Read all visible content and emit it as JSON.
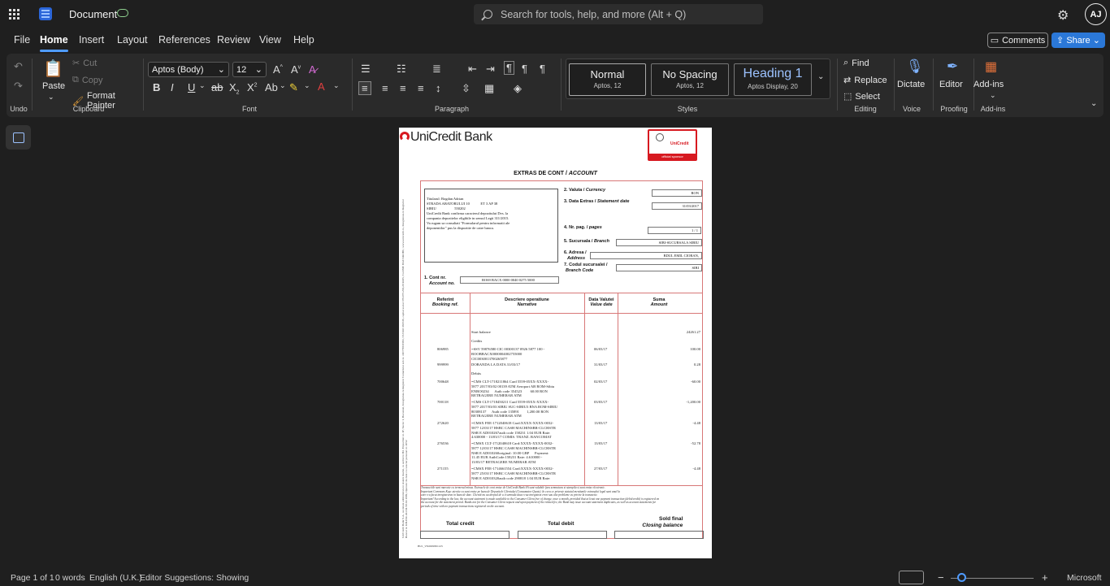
{
  "titlebar": {
    "doc_title": "Document",
    "search_placeholder": "Search for tools, help, and more (Alt + Q)",
    "avatar_initials": "AJ"
  },
  "menu": [
    "File",
    "Home",
    "Insert",
    "Layout",
    "References",
    "Review",
    "View",
    "Help"
  ],
  "actions": {
    "comments": "Comments",
    "share": "Share"
  },
  "ribbon": {
    "undo_label": "Undo",
    "clipboard": {
      "paste": "Paste",
      "cut": "Cut",
      "copy": "Copy",
      "format_painter": "Format Painter",
      "label": "Clipboard"
    },
    "font": {
      "family": "Aptos (Body)",
      "size": "12",
      "label": "Font"
    },
    "paragraph_label": "Paragraph",
    "styles": {
      "label": "Styles",
      "items": [
        {
          "name": "Normal",
          "sub": "Aptos, 12"
        },
        {
          "name": "No Spacing",
          "sub": "Aptos, 12"
        },
        {
          "name": "Heading 1",
          "sub": "Aptos Display, 20"
        }
      ]
    },
    "editing": {
      "find": "Find",
      "replace": "Replace",
      "select": "Select",
      "label": "Editing"
    },
    "voice": {
      "dictate": "Dictate",
      "label": "Voice"
    },
    "proofing": {
      "editor": "Editor",
      "label": "Proofing"
    },
    "addins": {
      "addins": "Add-ins",
      "label": "Add-ins"
    }
  },
  "statement": {
    "bank_name": "UniCredit Bank",
    "sponsor": "UniCredit",
    "sponsor_sub": "official sponsor",
    "title": "EXTRAS DE CONT",
    "title_en": "ACCOUNT",
    "address_lines": [
      "Titularul: Bogdan Adrian",
      "STRADA ABATORULUI 10            ET 3 AP 38",
      "SIBIU                    550202",
      "UniCredit Bank confirma caracterul depozitului Dvs. la",
      "compania depozitelor eligibile in sensul Legii 311/2015.",
      "Va rugam sa consultati \"Formularul pentru informatii ale",
      "deponentilor\" pus la dispozitie de catre banca."
    ],
    "fields": {
      "currency_label": "2. Valuta /",
      "currency_label_en": "Currency",
      "currency": "RON",
      "date_label": "3. Data Extras /",
      "date_label_en": "Statement date",
      "date": "31/03/2017",
      "pages_label": "4. Nr. pag. /",
      "pages_label_en": "pages",
      "pages": "1 /    1",
      "branch_label": "5. Sucursala /",
      "branch_label_en": "Branch",
      "branch": "SIBI-SUCURSALA SIBIU",
      "address_label": "6. Adresa /",
      "address_label_en": "Address",
      "address": "BDUL EMIL CIORAN,",
      "code_label": "7. Codul sucursalei /",
      "code_label_en": "Branch Code",
      "code": "SIBI",
      "account_label": "1. Cont nr.",
      "account_label_en": "Account no.",
      "account": "RO69 BACX 0000 0040 0275 5000"
    },
    "columns": [
      {
        "ro": "Referint",
        "en": "Booking ref."
      },
      {
        "ro": "Descriere operatiune",
        "en": "Narrative"
      },
      {
        "ro": "Data Valutei",
        "en": "Value date"
      },
      {
        "ro": "Suma",
        "en": "Amount"
      }
    ],
    "rows": [
      {
        "ref": "",
        "desc": "Start balance",
        "date": "",
        "amount": "24261.27"
      },
      {
        "ref": "",
        "desc": "Credits",
        "date": "",
        "amount": ""
      },
      {
        "ref": "806985",
        "desc": "=SSV 59876580 CIC 00300137 0926 5877 100 -\nROOBBACX0000004002755000\nCIC0030013700265877",
        "date": "06/03/17",
        "amount": "100.00"
      },
      {
        "ref": "999999",
        "desc": "DOBANDA LA DATA 31/03/17",
        "date": "31/03/17",
        "amount": "0.28"
      },
      {
        "ref": "",
        "desc": "Debits",
        "date": "",
        "amount": ""
      },
      {
        "ref": "700648",
        "desc": "=CMS CLT-1718211864 Card 5559-05XX-XXXX-\n5877 2017/03/02 00139 ATM Aeroport AB ROM-Sibiu\nENRO0234      Auth code 354523         60.00 RON\nRETRAGERE NUMERAR ATM",
        "date": "02/03/17",
        "amount": "-60.00"
      },
      {
        "ref": "700118",
        "desc": "=CMS CLT-1718450211 Card 5559-05XX-XXXX-\n5877 2017/03/03 SIBIU SUC-SIBIU3 BNA ROM-SIBIU\n80308137      Auth code 135891        1,200.00 RON\nRETRAGERE NUMERAR ATM",
        "date": "03/03/17",
        "amount": "-1,200.00"
      },
      {
        "ref": "272620",
        "desc": "=CMSX FEE-1712040618 Card:XXXX-XXXX-0032-\n5877 12/03/17 HSBC CASH MACHINSBR-CLCHSTR\nNSR E AD010267auth code 158231 1.04 EUR Rate:\n4.630000 - 13/03/17 COMIS. TRANZ. BANCOMAT",
        "date": "13/03/17",
        "amount": "-4.48"
      },
      {
        "ref": "276536",
        "desc": "=CMSX CLT-1712040618 Card:XXXX-XXXX-0032-\n5877 12/03/17 HSBC CASH MACHINSBR-CLCHSTR\nNSR E AD010260original: 10.00 GBP      Payment:\n11.45 EUR AuthCode:158231 Rate: 4.610000 -\n13/03/17 RETRAGERE NUMERAR ATM",
        "date": "13/03/17",
        "amount": "-52.78"
      },
      {
        "ref": "271155",
        "desc": "=CMSX FEE-1714661554 Card:XXXX-XXXX-0032-\n5877 25/03/17 HSBC CASH MACHINSBR-CLCHSTR\nNSR E AD010320auth code 290818 1.04 EUR Rate:",
        "date": "27/03/17",
        "amount": "-4.48"
      }
    ],
    "footer_lines": [
      "Tranzactiile sunt marcate cu termenul minus. Extrasele de cont emise de UniCredit Bank SA sunt valabile fara semnatura si stampila si sunt emise electronic.",
      "Important Commons Kap: atentie ca sunt emise pe baza de Depozitele Clientului (Consumator Quota). In ceea ce priveste statutul mentiunile extrasului legal sunt anul la",
      "care s-a facut inregistrarea in baza de date. Clientii nu au dreptul de a ii semnala daca s-au inregistrat erori sau alte probleme cu privire la tranzactie.",
      "Important! According to the law, the account statement is made available to the Consumer Client free of charge, once a month, provided that at least one payment transaction (debit/credit) is registered on",
      "the account for the statement period. Banks not for the Consumer Client request and upon payment of the related fee, the Bank may issue account statement duplicates, as well as account statements for",
      "periods of time with no payment transactions registered on the account."
    ],
    "side_text": "UniCredit Bank S.A., societate administrata in sistem dualist, cu sediul in Bd. Expozitiei nr. 1F, Sector 1, Bucuresti, Inregistrata la Registrul Comertului sub nr. J40/7706/1991, CUI RO 361536, capital social 379.075.291,20 RON, Cod BIC BACXROBU, www.unicredit.ro, Inregistrata in Registrul Bancar nr. RB-PJR-40-011/18.02.1999, Operator de date cu caracter personal nr. 2052",
    "totals": {
      "credit": "Total credit",
      "debit": "Total debit",
      "final": "Sold final",
      "final_en": "Closing balance"
    },
    "version": "BU1_V8.0609301125"
  },
  "status": {
    "page": "Page 1 of 1",
    "words": "0 words",
    "language": "English (U.K.)",
    "suggestions": "Editor Suggestions: Showing",
    "zoom_minus": "−",
    "zoom_plus": "+",
    "brand": "Microsoft"
  }
}
